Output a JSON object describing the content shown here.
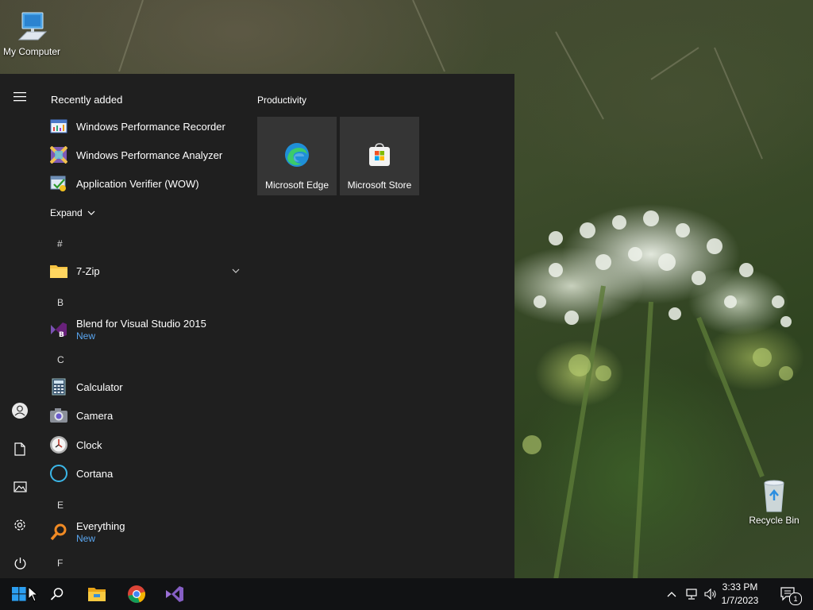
{
  "desktop": {
    "my_computer": "My Computer",
    "recycle_bin": "Recycle Bin"
  },
  "start_menu": {
    "recently_added_header": "Recently added",
    "recent": [
      {
        "label": "Windows Performance Recorder",
        "icon": "performance-recorder-icon"
      },
      {
        "label": "Windows Performance Analyzer",
        "icon": "performance-analyzer-icon"
      },
      {
        "label": "Application Verifier (WOW)",
        "icon": "application-verifier-icon"
      }
    ],
    "expand_label": "Expand",
    "letters": {
      "hash": "#",
      "b": "B",
      "c": "C",
      "e": "E",
      "f": "F"
    },
    "apps": {
      "seven_zip": {
        "label": "7-Zip"
      },
      "blend": {
        "label": "Blend for Visual Studio 2015",
        "badge": "New"
      },
      "calculator": {
        "label": "Calculator"
      },
      "camera": {
        "label": "Camera"
      },
      "clock": {
        "label": "Clock"
      },
      "cortana": {
        "label": "Cortana"
      },
      "everything": {
        "label": "Everything",
        "badge": "New"
      }
    },
    "productivity_header": "Productivity",
    "tiles": [
      {
        "label": "Microsoft Edge",
        "icon": "edge-icon"
      },
      {
        "label": "Microsoft Store",
        "icon": "store-icon"
      }
    ]
  },
  "taskbar": {
    "clock_time": "3:33 PM",
    "clock_date": "1/7/2023",
    "notification_count": "1",
    "accent": "#0078d7"
  }
}
